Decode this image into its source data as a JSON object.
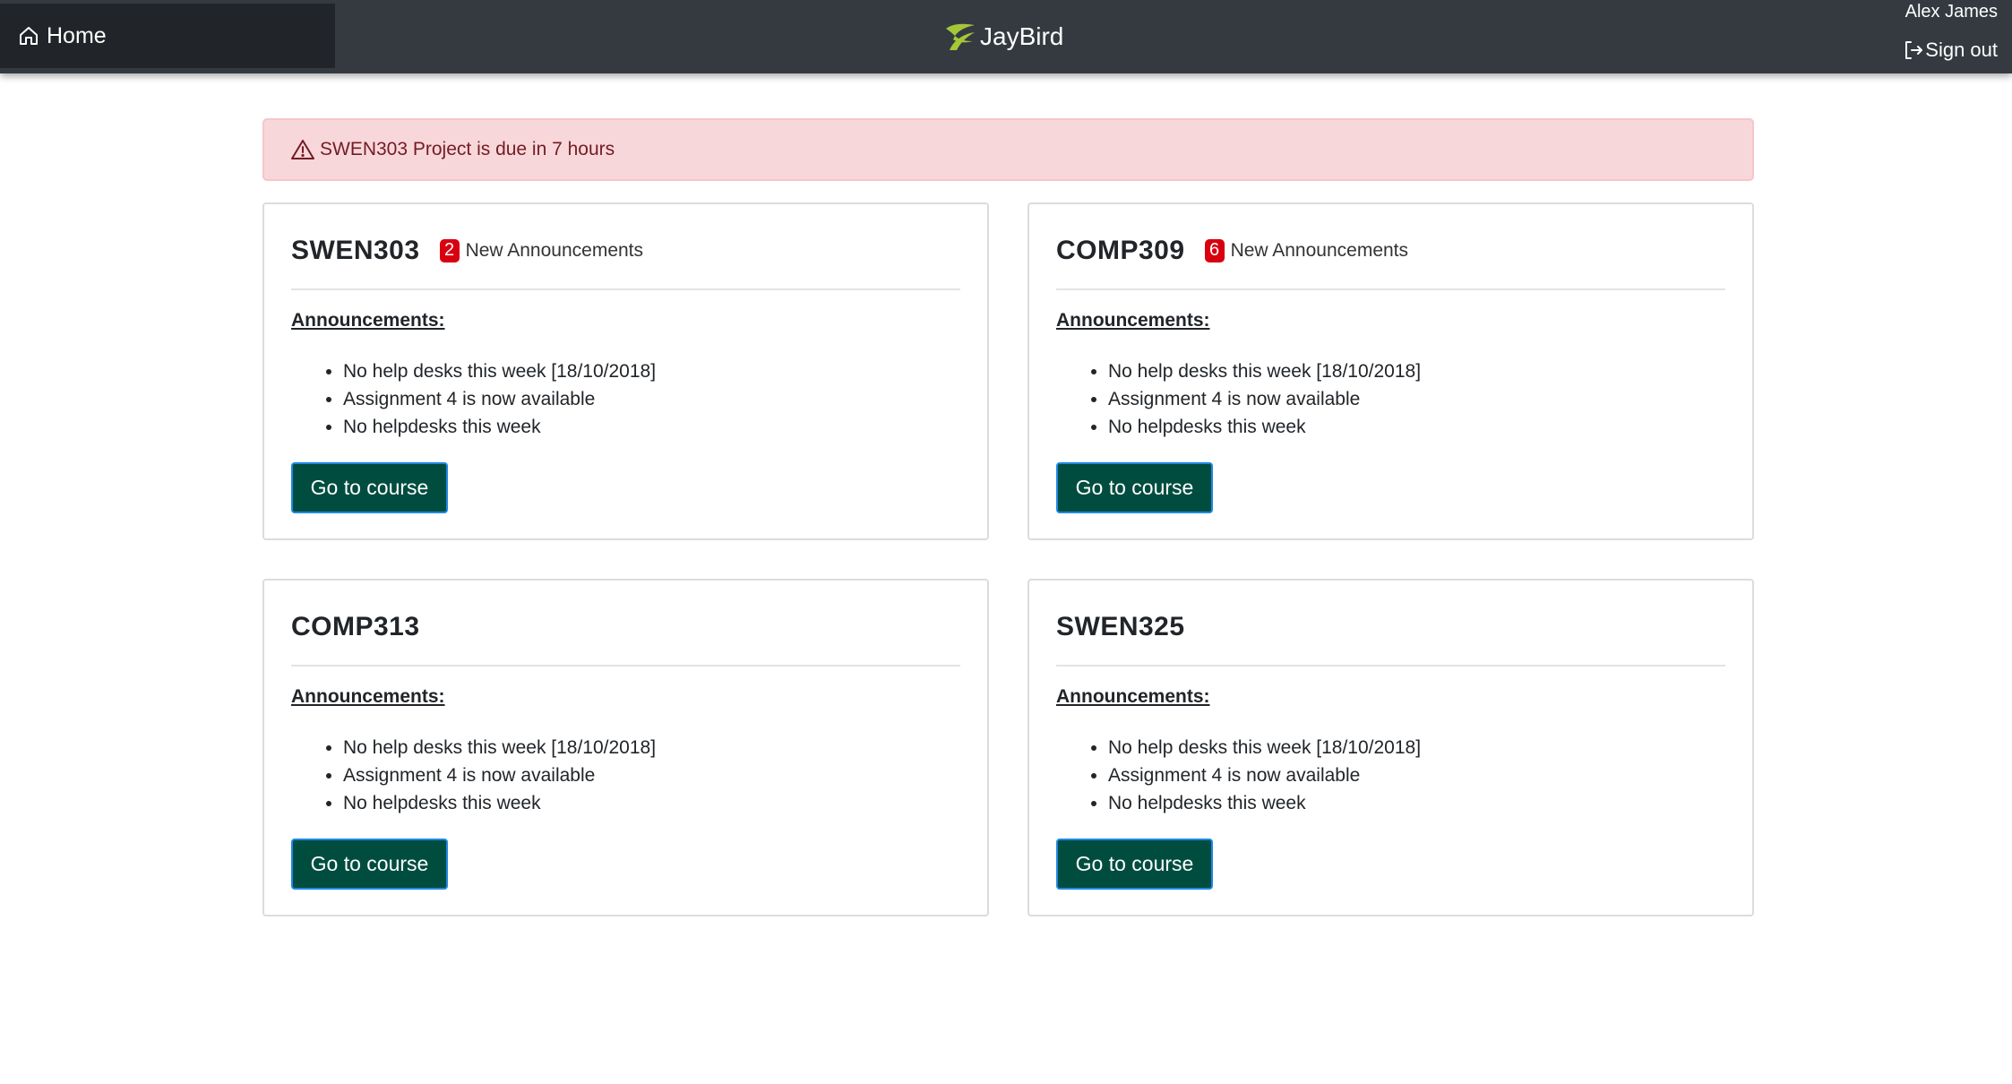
{
  "nav": {
    "home_label": "Home",
    "brand": "JayBird",
    "user_name": "Alex James",
    "signout_label": "Sign out"
  },
  "alert": {
    "text": "SWEN303 Project is due in 7 hours"
  },
  "courses": [
    {
      "code": "SWEN303",
      "new_count": "2",
      "new_label": "New Announcements",
      "announcements_heading": "Announcements:",
      "announcements": [
        "No help desks this week [18/10/2018]",
        "Assignment 4 is now available",
        "No helpdesks this week"
      ],
      "button_label": "Go to course"
    },
    {
      "code": "COMP309",
      "new_count": "6",
      "new_label": "New Announcements",
      "announcements_heading": "Announcements:",
      "announcements": [
        "No help desks this week [18/10/2018]",
        "Assignment 4 is now available",
        "No helpdesks this week"
      ],
      "button_label": "Go to course"
    },
    {
      "code": "COMP313",
      "announcements_heading": "Announcements:",
      "announcements": [
        "No help desks this week [18/10/2018]",
        "Assignment 4 is now available",
        "No helpdesks this week"
      ],
      "button_label": "Go to course"
    },
    {
      "code": "SWEN325",
      "announcements_heading": "Announcements:",
      "announcements": [
        "No help desks this week [18/10/2018]",
        "Assignment 4 is now available",
        "No helpdesks this week"
      ],
      "button_label": "Go to course"
    }
  ],
  "colors": {
    "topbar": "#343a40",
    "alert_bg": "#f8d7da",
    "alert_text": "#721c24",
    "badge": "#d80010",
    "button": "#004d40",
    "brand_logo": "#a4c639"
  }
}
